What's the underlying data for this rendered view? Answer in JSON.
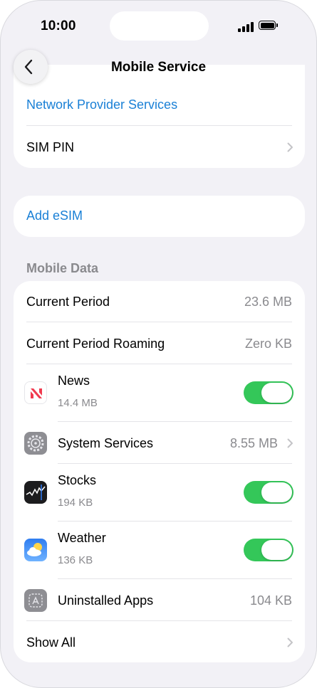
{
  "status_bar": {
    "time": "10:00"
  },
  "nav": {
    "title": "Mobile Service"
  },
  "group1": {
    "network_provider_services": "Network Provider Services",
    "sim_pin": "SIM PIN"
  },
  "group2": {
    "add_esim": "Add eSIM"
  },
  "mobile_data": {
    "header": "Mobile Data",
    "current_period": {
      "label": "Current Period",
      "value": "23.6 MB"
    },
    "current_period_roaming": {
      "label": "Current Period Roaming",
      "value": "Zero KB"
    },
    "apps": [
      {
        "name": "News",
        "usage": "14.4 MB",
        "enabled": true,
        "icon": "news-icon"
      },
      {
        "name": "System Services",
        "usage": "8.55 MB",
        "icon": "system-services-icon"
      },
      {
        "name": "Stocks",
        "usage": "194 KB",
        "enabled": true,
        "icon": "stocks-icon"
      },
      {
        "name": "Weather",
        "usage": "136 KB",
        "enabled": true,
        "icon": "weather-icon"
      },
      {
        "name": "Uninstalled Apps",
        "usage": "104 KB",
        "icon": "uninstalled-apps-icon"
      }
    ],
    "show_all": "Show All"
  },
  "colors": {
    "accent": "#1a80d6",
    "toggle_on": "#34c759",
    "secondary_text": "#8a8a8e",
    "background": "#f2f1f6"
  }
}
